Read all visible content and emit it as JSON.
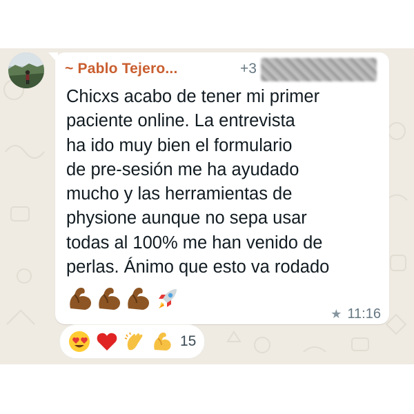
{
  "message": {
    "sender_name": "~ Pablo Tejero...",
    "sender_phone_prefix": "+3",
    "text": "Chicxs acabo de tener mi primer\npaciente online. La entrevista\nha ido muy bien el formulario\nde pre-sesión me ha ayudado\nmucho y las herramientas de\nphysione aunque no sepa usar\ntodas al 100% me han venido de\nperlas. Ánimo que esto va rodado",
    "emojis": [
      "flexed-biceps",
      "flexed-biceps",
      "flexed-biceps",
      "rocket"
    ],
    "starred": true,
    "time": "11:16"
  },
  "reactions": {
    "emojis": [
      "heart-eyes",
      "red-heart",
      "clapping-hands",
      "flexed-biceps"
    ],
    "count": "15"
  },
  "colors": {
    "chat_background": "#efeae2",
    "sender_name": "#c95e2f",
    "meta_text": "#667781",
    "message_text": "#111b21"
  }
}
